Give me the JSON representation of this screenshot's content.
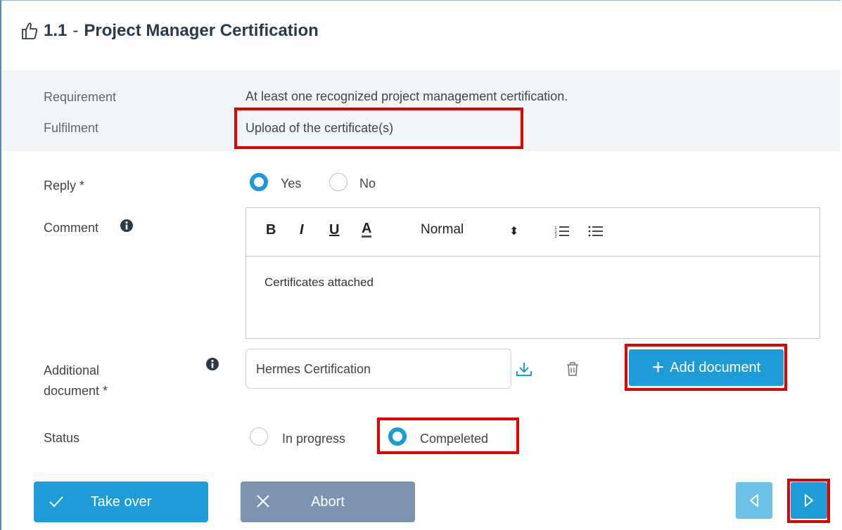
{
  "header": {
    "number": "1.1",
    "separator": "-",
    "title": "Project Manager Certification"
  },
  "info": {
    "requirement_label": "Requirement",
    "requirement_value": "At least one recognized project management certification.",
    "fulfilment_label": "Fulfilment",
    "fulfilment_value": "Upload of the certificate(s)"
  },
  "reply": {
    "label": "Reply *",
    "options": [
      {
        "label": "Yes",
        "selected": true
      },
      {
        "label": "No",
        "selected": false
      }
    ]
  },
  "comment": {
    "label": "Comment",
    "toolbar": {
      "bold": "B",
      "italic": "I",
      "underline": "U",
      "color": "A",
      "format": "Normal",
      "format_arrow": "⬍"
    },
    "text": "Certificates attached"
  },
  "document": {
    "label_line1": "Additional",
    "label_line2": "document *",
    "value": "Hermes Certification",
    "add_label": "Add document"
  },
  "status": {
    "label": "Status",
    "options": [
      {
        "label": "In progress",
        "selected": false
      },
      {
        "label": "Compeleted",
        "selected": true
      }
    ]
  },
  "actions": {
    "take_over": "Take over",
    "abort": "Abort"
  },
  "colors": {
    "accent": "#1e9cd7",
    "highlight": "#e00000",
    "abort": "#7d93b2"
  }
}
